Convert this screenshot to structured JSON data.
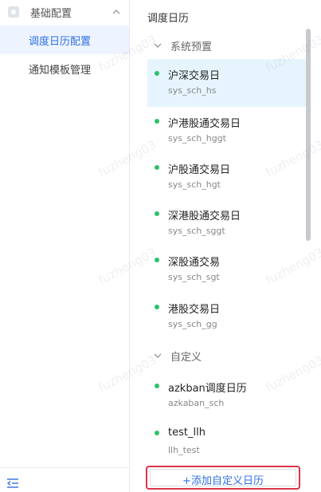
{
  "sidebar": {
    "group": {
      "label": "基础配置",
      "icon": "config-icon",
      "expanded": true
    },
    "items": [
      {
        "label": "调度日历配置",
        "active": true
      },
      {
        "label": "通知模板管理",
        "active": false
      }
    ],
    "footer_icon": "collapse-menu-icon"
  },
  "panel": {
    "title": "调度日历",
    "sections": [
      {
        "label": "系统预置",
        "items": [
          {
            "name": "沪深交易日",
            "code": "sys_sch_hs",
            "selected": true
          },
          {
            "name": "沪港股通交易日",
            "code": "sys_sch_hggt",
            "selected": false
          },
          {
            "name": "沪股通交易日",
            "code": "sys_sch_hgt",
            "selected": false
          },
          {
            "name": "深港股通交易日",
            "code": "sys_sch_sggt",
            "selected": false
          },
          {
            "name": "深股通交易",
            "code": "sys_sch_sgt",
            "selected": false
          },
          {
            "name": "港股交易日",
            "code": "sys_sch_gg",
            "selected": false
          }
        ]
      },
      {
        "label": "自定义",
        "items": [
          {
            "name": "azkban调度日历",
            "code": "azkaban_sch",
            "selected": false
          },
          {
            "name": "test_llh",
            "code": "llh_test",
            "selected": false
          }
        ]
      }
    ],
    "add_button": "+添加自定义日历"
  },
  "watermark": "fuzheng03",
  "colors": {
    "accent": "#2f6fe4",
    "selected_bg": "#e6f5fd",
    "status_dot": "#2cc26a",
    "highlight_border": "#d93649"
  }
}
